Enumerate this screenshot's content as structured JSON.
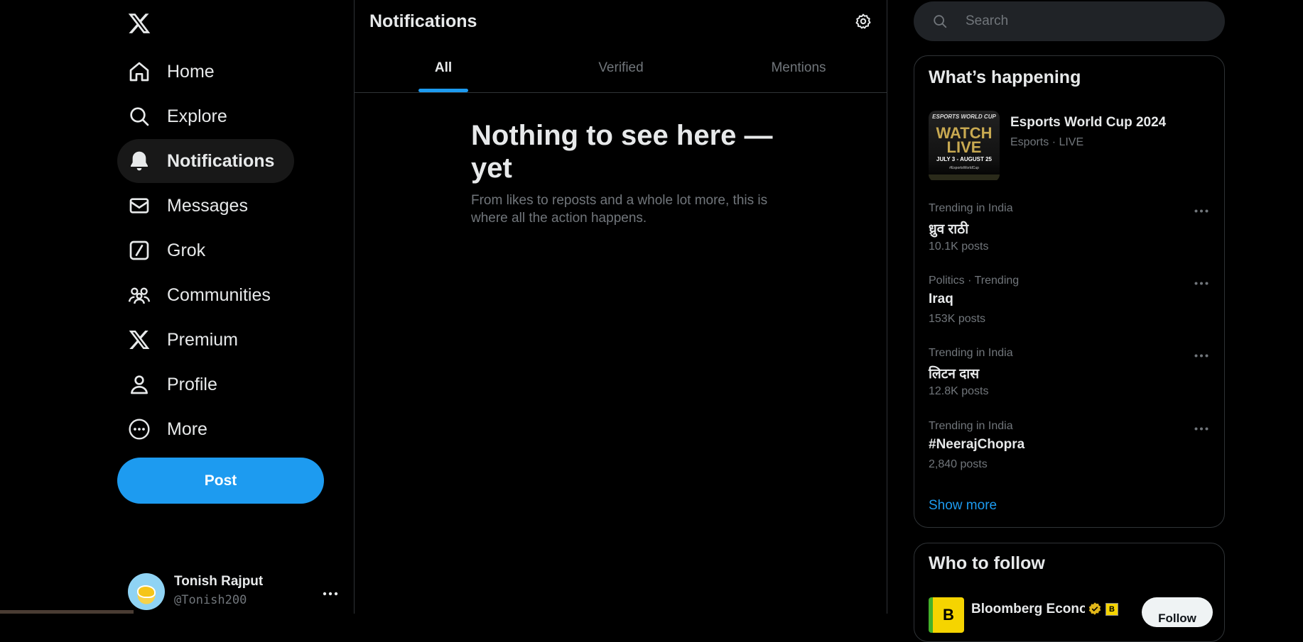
{
  "colors": {
    "background": "#000000",
    "accent": "#1d9bf0",
    "text_primary": "#e7e9ea",
    "text_secondary": "#71767b",
    "border": "#2f3336",
    "active_nav_bg": "#181818",
    "search_bg": "#202327"
  },
  "sidebar": {
    "logo_icon": "x-logo-icon",
    "items": [
      {
        "label": "Home",
        "icon": "home-icon",
        "active": false
      },
      {
        "label": "Explore",
        "icon": "search-icon",
        "active": false
      },
      {
        "label": "Notifications",
        "icon": "bell-icon",
        "active": true
      },
      {
        "label": "Messages",
        "icon": "envelope-icon",
        "active": false
      },
      {
        "label": "Grok",
        "icon": "grok-icon",
        "active": false
      },
      {
        "label": "Communities",
        "icon": "people-icon",
        "active": false
      },
      {
        "label": "Premium",
        "icon": "x-logo-icon",
        "active": false
      },
      {
        "label": "Profile",
        "icon": "person-icon",
        "active": false
      },
      {
        "label": "More",
        "icon": "more-circle-icon",
        "active": false
      }
    ],
    "post_label": "Post",
    "account": {
      "name": "Tonish Rajput",
      "handle": "@Tonish200"
    }
  },
  "main": {
    "title": "Notifications",
    "tabs": [
      {
        "label": "All",
        "active": true
      },
      {
        "label": "Verified",
        "active": false
      },
      {
        "label": "Mentions",
        "active": false
      }
    ],
    "empty_title": "Nothing to see here — yet",
    "empty_subtitle": "From likes to reposts and a whole lot more, this is where all the action happens."
  },
  "right": {
    "search": {
      "placeholder": "Search"
    },
    "whats_happening": {
      "title": "What’s happening",
      "featured": {
        "title": "Esports World Cup 2024",
        "meta": "Esports · LIVE",
        "image_top": "ESPORTS WORLD CUP",
        "image_main_1": "WATCH",
        "image_main_2": "LIVE",
        "image_date": "JULY 3 - AUGUST 25",
        "image_tag": "#EsportsWorldCup"
      },
      "trends": [
        {
          "context": "Trending in India",
          "name": "ध्रुव राठी",
          "count": "10.1K posts"
        },
        {
          "context": "Politics · Trending",
          "name": "Iraq",
          "count": "153K posts"
        },
        {
          "context": "Trending in India",
          "name": "लिटन दास",
          "count": "12.8K posts"
        },
        {
          "context": "Trending in India",
          "name": "#NeerajChopra",
          "count": "2,840 posts"
        }
      ],
      "show_more": "Show more"
    },
    "who_to_follow": {
      "title": "Who to follow",
      "accounts": [
        {
          "name": "Bloomberg Econom",
          "avatar_letter": "B",
          "badge_letter": "B",
          "follow_label": "Follow"
        }
      ]
    }
  }
}
